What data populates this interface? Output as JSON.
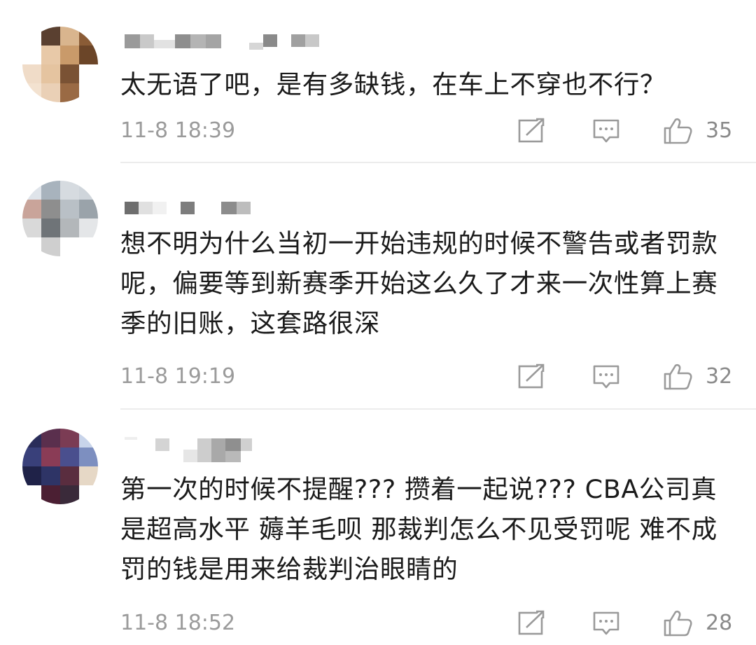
{
  "comments": [
    {
      "text": "太无语了吧，是有多缺钱，在车上不穿也不行？",
      "time": "11-8 18:39",
      "likes": "35",
      "avatar_colors": [
        "#ffffff",
        "#5a4030",
        "#d9b58e",
        "#8a5c36",
        "#ffffff",
        "#e8c9a8",
        "#c99a6a",
        "#6b4528",
        "#f0dcc8",
        "#e5c4a0",
        "#7a5234",
        "#ffffff",
        "#f3e2d0",
        "#ead0b6",
        "#9a6a44",
        "#ffffff"
      ]
    },
    {
      "text": "想不明为什么当初一开始违规的时候不警告或者罚款呢，偏要等到新赛季开始这么久了才来一次性算上赛季的旧账，这套路很深",
      "time": "11-8 19:19",
      "likes": "32",
      "avatar_colors": [
        "#dfe4ea",
        "#a8b3bd",
        "#d6dbe0",
        "#cfd5db",
        "#c9a49a",
        "#8e8e8e",
        "#b9c0c6",
        "#9aa3aa",
        "#d9d9d9",
        "#6f7478",
        "#b3b7ba",
        "#e4e6e8",
        "#ffffff",
        "#cfcfcf",
        "#ffffff",
        "#ffffff"
      ]
    },
    {
      "text": "第一次的时候不提醒???  攒着一起说???  CBA公司真是超高水平  薅羊毛呗  那裁判怎么不见受罚呢  难不成罚的钱是用来给裁判治眼睛的",
      "time": "11-8 18:52",
      "likes": "28",
      "avatar_colors": [
        "#2a2d5a",
        "#5a2f4d",
        "#7b3c54",
        "#c8d4ea",
        "#39407a",
        "#8a3c56",
        "#4a4f8e",
        "#7d8fc0",
        "#1f2248",
        "#2e3466",
        "#5a2d3f",
        "#e6d8c6",
        "#ffffff",
        "#4b1f33",
        "#3a2a3a",
        "#ffffff"
      ]
    }
  ]
}
